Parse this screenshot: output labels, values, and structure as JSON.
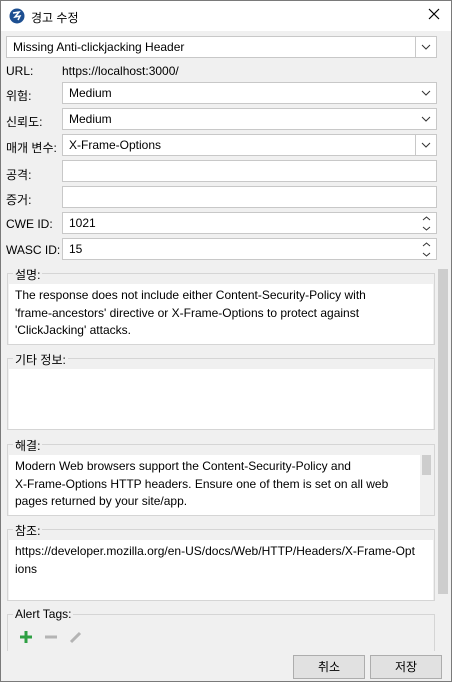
{
  "window": {
    "title": "경고 수정",
    "app_icon": "zap-logo-icon"
  },
  "alert_name": "Missing Anti-clickjacking Header",
  "url": {
    "label": "URL:",
    "value": "https://localhost:3000/"
  },
  "risk": {
    "label": "위험:",
    "value": "Medium"
  },
  "confidence": {
    "label": "신뢰도:",
    "value": "Medium"
  },
  "parameter": {
    "label": "매개 변수:",
    "value": "X-Frame-Options"
  },
  "attack": {
    "label": "공격:",
    "value": ""
  },
  "evidence": {
    "label": "증거:",
    "value": ""
  },
  "cwe": {
    "label": "CWE ID:",
    "value": "1021"
  },
  "wasc": {
    "label": "WASC ID:",
    "value": "15"
  },
  "description": {
    "label": "설명:",
    "lines": [
      "The response does not include either Content-Security-Policy with",
      "'frame-ancestors' directive or X-Frame-Options to protect against",
      "'ClickJacking' attacks."
    ]
  },
  "other_info": {
    "label": "기타 정보:",
    "value": ""
  },
  "solution": {
    "label": "해결:",
    "lines": [
      "Modern Web browsers support the Content-Security-Policy and",
      "X-Frame-Options HTTP headers. Ensure one of them is set on all web",
      "pages returned by your site/app."
    ]
  },
  "reference": {
    "label": "참조:",
    "lines": [
      "https://developer.mozilla.org/en-US/docs/Web/HTTP/Headers/X-Frame-Opt",
      "ions"
    ]
  },
  "alert_tags": {
    "label": "Alert Tags:"
  },
  "buttons": {
    "cancel": "취소",
    "save": "저장"
  },
  "colors": {
    "add": "#2ea043",
    "disabled": "#b4b4b4",
    "accent": "#0078d7"
  }
}
